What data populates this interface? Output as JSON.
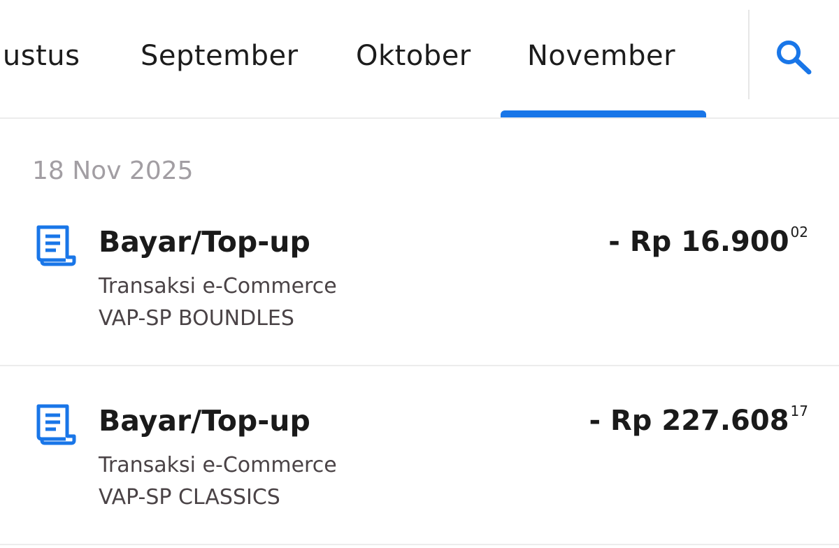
{
  "tabs": {
    "items": [
      {
        "label": "gustus"
      },
      {
        "label": "September"
      },
      {
        "label": "Oktober"
      },
      {
        "label": "November"
      }
    ],
    "active_index": 3,
    "accent_color": "#1976e8",
    "search_icon": "search-icon"
  },
  "date_group": {
    "label": "18 Nov 2025"
  },
  "transactions": [
    {
      "icon": "receipt-icon",
      "title": "Bayar/Top-up",
      "category": "Transaksi e-Commerce",
      "merchant": "VAP-SP BOUNDLES",
      "amount_main": "- Rp 16.900",
      "amount_cents": "02"
    },
    {
      "icon": "receipt-icon",
      "title": "Bayar/Top-up",
      "category": "Transaksi e-Commerce",
      "merchant": "VAP-SP CLASSICS",
      "amount_main": "- Rp 227.608",
      "amount_cents": "17"
    }
  ]
}
